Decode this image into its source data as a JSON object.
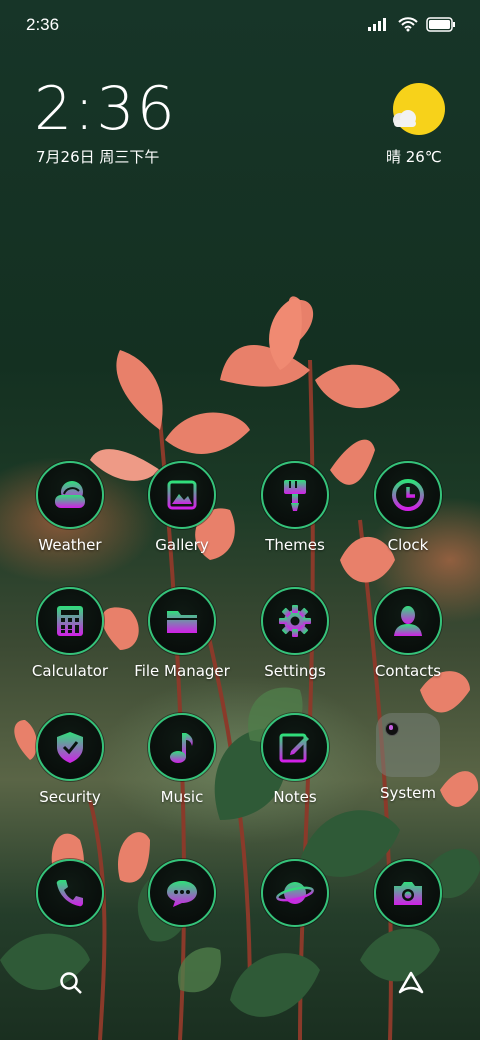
{
  "status_bar": {
    "time": "2:36"
  },
  "widget": {
    "clock": "2:36",
    "date": "7月26日 周三下午",
    "weather": "晴 26℃"
  },
  "apps": [
    {
      "label": "Weather",
      "icon": "weather-icon"
    },
    {
      "label": "Gallery",
      "icon": "gallery-icon"
    },
    {
      "label": "Themes",
      "icon": "themes-icon"
    },
    {
      "label": "Clock",
      "icon": "clock-icon"
    },
    {
      "label": "Calculator",
      "icon": "calculator-icon"
    },
    {
      "label": "File Manager",
      "icon": "folder-icon"
    },
    {
      "label": "Settings",
      "icon": "gear-icon"
    },
    {
      "label": "Contacts",
      "icon": "contact-icon"
    },
    {
      "label": "Security",
      "icon": "shield-icon"
    },
    {
      "label": "Music",
      "icon": "music-note-icon"
    },
    {
      "label": "Notes",
      "icon": "notes-icon"
    },
    {
      "label": "System",
      "icon": "folder-icon"
    }
  ],
  "dock": [
    {
      "icon": "phone-icon"
    },
    {
      "icon": "message-icon"
    },
    {
      "icon": "browser-icon"
    },
    {
      "icon": "camera-icon"
    }
  ],
  "colors": {
    "icon_ring": "#35c27a",
    "icon_gradient_start": "#2fe07a",
    "icon_gradient_end": "#d21fe8"
  }
}
